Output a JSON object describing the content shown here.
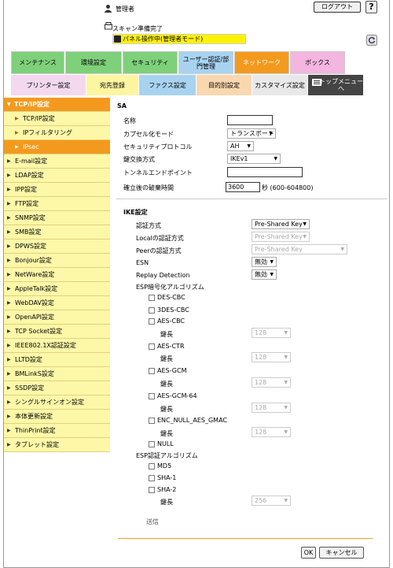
{
  "header": {
    "user_label": "管理者",
    "logout_label": "ログアウト",
    "help_label": "?",
    "scan_status": "スキャン準備完了",
    "panel_status": "パネル操作中(管理者モード)"
  },
  "tabs": [
    {
      "label": "メンテナンス",
      "color": "#7fd07a"
    },
    {
      "label": "環境設定",
      "color": "#7fd07a"
    },
    {
      "label": "セキュリティ",
      "color": "#7fd07a"
    },
    {
      "label": "ユーザー認証/部門管理",
      "color": "#a8d3f0"
    },
    {
      "label": "ネットワーク",
      "color": "#f39a1e"
    },
    {
      "label": "ボックス",
      "color": "#f3b6e0"
    }
  ],
  "subtabs": [
    {
      "label": "プリンター設定",
      "color": "#f3d8ef"
    },
    {
      "label": "宛先登録",
      "color": "#fdf5a0"
    },
    {
      "label": "ファクス設定",
      "color": "#a8d3f0"
    },
    {
      "label": "目的別設定",
      "color": "#f9d8b0"
    },
    {
      "label": "カスタマイズ設定",
      "color": "#e8e8e8"
    },
    {
      "label": "トップメニューへ",
      "color": "#444"
    }
  ],
  "sidebar": [
    {
      "label": "TCP/IP設定",
      "state": "active"
    },
    {
      "label": "TCP/IP設定",
      "state": "sub"
    },
    {
      "label": "IPフィルタリング",
      "state": "sub"
    },
    {
      "label": "IPsec",
      "state": "subactive"
    },
    {
      "label": "E-mail設定",
      "state": ""
    },
    {
      "label": "LDAP設定",
      "state": ""
    },
    {
      "label": "IPP設定",
      "state": ""
    },
    {
      "label": "FTP設定",
      "state": ""
    },
    {
      "label": "SNMP設定",
      "state": ""
    },
    {
      "label": "SMB設定",
      "state": ""
    },
    {
      "label": "DPWS設定",
      "state": ""
    },
    {
      "label": "Bonjour設定",
      "state": ""
    },
    {
      "label": "NetWare設定",
      "state": ""
    },
    {
      "label": "AppleTalk設定",
      "state": ""
    },
    {
      "label": "WebDAV設定",
      "state": ""
    },
    {
      "label": "OpenAPI設定",
      "state": ""
    },
    {
      "label": "TCP Socket設定",
      "state": ""
    },
    {
      "label": "IEEE802.1X認証設定",
      "state": ""
    },
    {
      "label": "LLTD設定",
      "state": ""
    },
    {
      "label": "BMLinkS設定",
      "state": ""
    },
    {
      "label": "SSDP設定",
      "state": ""
    },
    {
      "label": "シングルサインオン設定",
      "state": ""
    },
    {
      "label": "本体更新設定",
      "state": ""
    },
    {
      "label": "ThinPrint設定",
      "state": ""
    },
    {
      "label": "タブレット設定",
      "state": ""
    }
  ],
  "sa": {
    "section_title": "SA",
    "name_label": "名称",
    "name_value": "",
    "encap_label": "カプセル化モード",
    "encap_value": "トランスポート",
    "protocol_label": "セキュリティプロトコル",
    "protocol_value": "AH",
    "keyex_label": "鍵交換方式",
    "keyex_value": "IKEv1",
    "tunnel_label": "トンネルエンドポイント",
    "tunnel_value": "",
    "discard_label": "確立後の破棄時間",
    "discard_value": "3600",
    "discard_unit": "秒 (600-604800)"
  },
  "ike": {
    "section_title": "IKE設定",
    "auth_label": "認証方式",
    "auth_value": "Pre-Shared Key",
    "local_label": "Localの認証方式",
    "local_value": "Pre-Shared Key",
    "peer_label": "Peerの認証方式",
    "peer_value": "Pre-Shared Key",
    "esn_label": "ESN",
    "esn_value": "無効",
    "replay_label": "Replay Detection",
    "replay_value": "無効",
    "esp_enc_label": "ESP暗号化アルゴリズム",
    "enc": [
      {
        "label": "DES-CBC"
      },
      {
        "label": "3DES-CBC"
      },
      {
        "label": "AES-CBC",
        "key_label": "鍵長",
        "key_value": "128"
      },
      {
        "label": "AES-CTR",
        "key_label": "鍵長",
        "key_value": "128"
      },
      {
        "label": "AES-GCM",
        "key_label": "鍵長",
        "key_value": "128"
      },
      {
        "label": "AES-GCM-64",
        "key_label": "鍵長",
        "key_value": "128"
      },
      {
        "label": "ENC_NULL_AES_GMAC",
        "key_label": "鍵長",
        "key_value": "128"
      },
      {
        "label": "NULL"
      }
    ],
    "esp_auth_label": "ESP認証アルゴリズム",
    "auth_alg": [
      {
        "label": "MD5"
      },
      {
        "label": "SHA-1"
      },
      {
        "label": "SHA-2",
        "key_label": "鍵長",
        "key_value": "256"
      }
    ],
    "more_label": "送信"
  },
  "buttons": {
    "ok": "OK",
    "cancel": "キャンセル"
  }
}
